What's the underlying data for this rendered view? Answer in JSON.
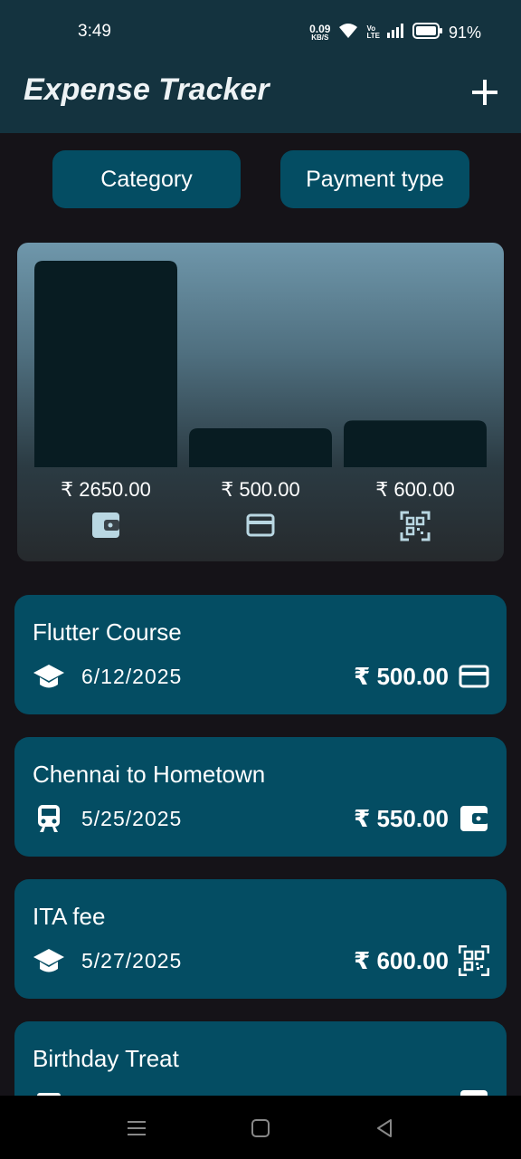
{
  "status_bar": {
    "time": "3:49",
    "net_speed_value": "0.09",
    "net_speed_unit": "KB/S",
    "volte_top": "Vo",
    "volte_bottom": "LTE",
    "battery_percent": "91%"
  },
  "app_bar": {
    "title": "Expense Tracker",
    "add_icon": "plus-icon"
  },
  "filters": {
    "category_label": "Category",
    "payment_type_label": "Payment type"
  },
  "chart_data": {
    "type": "bar",
    "categories": [
      "wallet",
      "card",
      "qr-code"
    ],
    "category_icons": [
      "wallet-icon",
      "credit-card-icon",
      "qr-code-icon"
    ],
    "values": [
      2650,
      500,
      600
    ],
    "value_labels": [
      "₹ 2650.00",
      "₹ 500.00",
      "₹ 600.00"
    ],
    "ylim": [
      0,
      2650
    ],
    "bar_color": "#081c22"
  },
  "expenses": [
    {
      "title": "Flutter Course",
      "category_icon": "graduation-cap-icon",
      "date": "6/12/2025",
      "amount": "₹ 500.00",
      "payment_icon": "credit-card-icon"
    },
    {
      "title": "Chennai to Hometown",
      "category_icon": "train-icon",
      "date": "5/25/2025",
      "amount": "₹ 550.00",
      "payment_icon": "wallet-icon"
    },
    {
      "title": "ITA fee",
      "category_icon": "graduation-cap-icon",
      "date": "5/27/2025",
      "amount": "₹ 600.00",
      "payment_icon": "qr-code-icon"
    },
    {
      "title": "Birthday Treat",
      "category_icon": "food-icon",
      "date": "",
      "amount": "",
      "payment_icon": "wallet-icon"
    }
  ],
  "colors": {
    "app_bar": "#14333f",
    "background": "#151318",
    "card": "#044d63",
    "accent": "#044d63"
  }
}
